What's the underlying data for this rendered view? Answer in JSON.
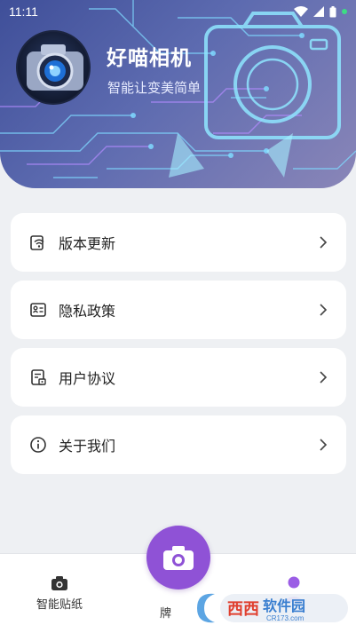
{
  "status_bar": {
    "time": "11:11"
  },
  "header": {
    "app_name": "好喵相机",
    "slogan": "智能让变美简单"
  },
  "menu": [
    {
      "label": "版本更新",
      "icon": "update-icon"
    },
    {
      "label": "隐私政策",
      "icon": "privacy-icon"
    },
    {
      "label": "用户协议",
      "icon": "agreement-icon"
    },
    {
      "label": "关于我们",
      "icon": "info-icon"
    }
  ],
  "bottom_nav": {
    "stickers_label": "智能贴纸",
    "brand_label": "牌",
    "camera_icon": "camera-icon",
    "mine_icon": "person-icon"
  },
  "watermark": {
    "brand": "西西",
    "text": "软件园",
    "url": "CR173.com"
  },
  "colors": {
    "accent": "#8f52d6",
    "header_start": "#3f4f99",
    "header_end": "#8a86b8",
    "background": "#eef0f3"
  }
}
